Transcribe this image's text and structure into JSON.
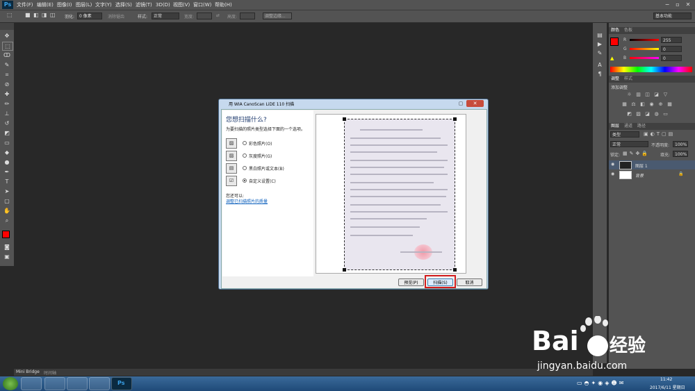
{
  "app": {
    "logo": "Ps"
  },
  "menu": [
    "文件(F)",
    "编辑(E)",
    "图像(I)",
    "图层(L)",
    "文字(Y)",
    "选择(S)",
    "滤镜(T)",
    "3D(D)",
    "视图(V)",
    "窗口(W)",
    "帮助(H)"
  ],
  "options_bar": {
    "feather_label": "羽化:",
    "feather_value": "0 像素",
    "antialias": "消除锯齿",
    "style_label": "样式:",
    "style_value": "正常",
    "width_label": "宽度:",
    "height_label": "高度:",
    "refine_edge": "调整边缘...",
    "workspace": "基本功能"
  },
  "color_panel": {
    "tabs": [
      "颜色",
      "色板"
    ],
    "channels": [
      {
        "label": "R",
        "value": "255"
      },
      {
        "label": "G",
        "value": "0"
      },
      {
        "label": "B",
        "value": "0"
      }
    ],
    "foreground": "#ff0000",
    "background": "#ffffff"
  },
  "adjust_panel": {
    "tabs": [
      "调整",
      "样式"
    ],
    "title": "添加调整"
  },
  "layers_panel": {
    "tabs": [
      "图层",
      "通道",
      "路径"
    ],
    "kind": "类型",
    "blend_mode": "正常",
    "opacity_label": "不透明度:",
    "opacity": "100%",
    "lock_label": "锁定:",
    "fill_label": "填充:",
    "fill": "100%",
    "layers": [
      {
        "name": "图层 1"
      },
      {
        "name": "背景"
      }
    ]
  },
  "dialog": {
    "title": "用 WIA CanoScan LiDE 110 扫描",
    "heading": "您想扫描什么?",
    "subheading": "为要扫描的照片类型选择下面的一个选项。",
    "options": [
      {
        "label": "彩色照片(O)",
        "selected": false
      },
      {
        "label": "灰度照片(G)",
        "selected": false
      },
      {
        "label": "黑白照片或文本(B)",
        "selected": false
      },
      {
        "label": "自定义设置(C)",
        "selected": true
      }
    ],
    "also_label": "您还可以:",
    "link": "调整已扫描照片的质量",
    "preview_button": "预览(P)",
    "scan_button": "扫描(S)",
    "cancel_button": "取消"
  },
  "bottom_tabs": [
    "Mini Bridge",
    "时间轴"
  ],
  "taskbar": {
    "time": "11:42",
    "date": "2017/6/11 星期日"
  },
  "watermark": {
    "text": "Bai",
    "text2": "经验",
    "url": "jingyan.baidu.com"
  }
}
